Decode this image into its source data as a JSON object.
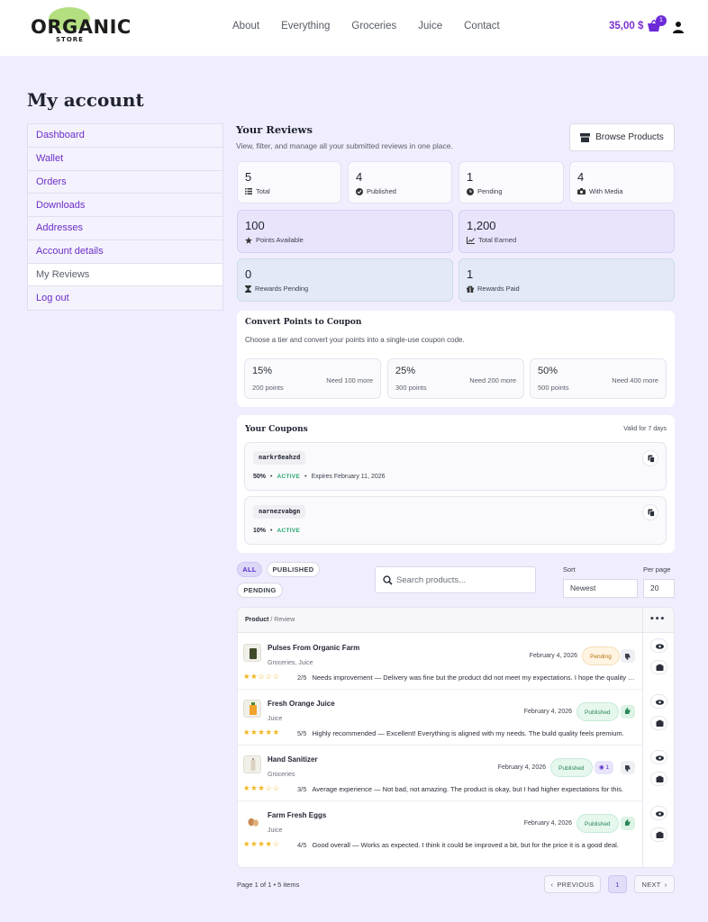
{
  "brand": {
    "logo_main": "ORGANIC",
    "logo_sub": "STORE"
  },
  "nav": [
    {
      "label": "About"
    },
    {
      "label": "Everything"
    },
    {
      "label": "Groceries"
    },
    {
      "label": "Juice"
    },
    {
      "label": "Contact"
    }
  ],
  "cart": {
    "total": "35,00 $",
    "count": "1"
  },
  "page_title": "My account",
  "sidebar": {
    "items": [
      {
        "label": "Dashboard"
      },
      {
        "label": "Wallet"
      },
      {
        "label": "Orders"
      },
      {
        "label": "Downloads"
      },
      {
        "label": "Addresses"
      },
      {
        "label": "Account details"
      },
      {
        "label": "My Reviews"
      },
      {
        "label": "Log out"
      }
    ],
    "active": "My Reviews"
  },
  "reviews": {
    "title": "Your Reviews",
    "subtitle": "View, filter, and manage all your submitted reviews in one place.",
    "browse_label": "Browse Products"
  },
  "stats": {
    "total": {
      "value": "5",
      "label": "Total"
    },
    "published": {
      "value": "4",
      "label": "Published"
    },
    "pending": {
      "value": "1",
      "label": "Pending"
    },
    "media": {
      "value": "4",
      "label": "With Media"
    },
    "points_available": {
      "value": "100",
      "label": "Points Available"
    },
    "total_earned": {
      "value": "1,200",
      "label": "Total Earned"
    },
    "rewards_pending": {
      "value": "0",
      "label": "Rewards Pending"
    },
    "rewards_paid": {
      "value": "1",
      "label": "Rewards Paid"
    }
  },
  "convert": {
    "title": "Convert Points to Coupon",
    "subtitle": "Choose a tier and convert your points into a single-use coupon code.",
    "tiers": [
      {
        "pct": "15%",
        "points": "200 points",
        "need": "Need 100 more"
      },
      {
        "pct": "25%",
        "points": "300 points",
        "need": "Need 200 more"
      },
      {
        "pct": "50%",
        "points": "500 points",
        "need": "Need 400 more"
      }
    ]
  },
  "coupons": {
    "title": "Your Coupons",
    "validity": "Valid for 7 days",
    "items": [
      {
        "code": "narkr8eahzd",
        "discount": "50%",
        "status": "ACTIVE",
        "expires": "Expires February 11, 2026"
      },
      {
        "code": "narnezvabgn",
        "discount": "10%",
        "status": "ACTIVE",
        "expires": ""
      }
    ]
  },
  "filters": {
    "all": "ALL",
    "published": "PUBLISHED",
    "pending": "PENDING",
    "search_placeholder": "Search products...",
    "sort_label": "Sort",
    "sort_value": "Newest",
    "per_page_label": "Per page",
    "per_page_value": "20"
  },
  "table": {
    "header_product": "Product",
    "header_review": "/ Review",
    "header_actions": "•••",
    "rows": [
      {
        "name": "Pulses From Organic Farm",
        "category": "Groceries, Juice",
        "date": "February 4, 2026",
        "status": "Pending",
        "rating": 2,
        "score": "2/5",
        "text": "Needs improvement — Delivery was fine but the product did not meet my expectations. I hope the quality gets better next time."
      },
      {
        "name": "Fresh Orange Juice",
        "category": "Juice",
        "date": "February 4, 2026",
        "status": "Published",
        "rating": 5,
        "score": "5/5",
        "text": "Highly recommended — Excellent! Everything is aligned with my needs. The build quality feels premium."
      },
      {
        "name": "Hand Sanitizer",
        "category": "Groceries",
        "date": "February 4, 2026",
        "status": "Published",
        "media_count": "1",
        "rating": 3,
        "score": "3/5",
        "text": "Average experience — Not bad, not amazing. The product is okay, but I had higher expectations for this."
      },
      {
        "name": "Farm Fresh Eggs",
        "category": "Juice",
        "date": "February 4, 2026",
        "status": "Published",
        "rating": 4,
        "score": "4/5",
        "text": "Good overall — Works as expected. I think it could be improved a bit, but for the price it is a good deal."
      }
    ]
  },
  "pagination": {
    "summary": "Page 1 of 1 • 5 items",
    "previous": "PREVIOUS",
    "current": "1",
    "next": "NEXT"
  },
  "colors": {
    "accent": "#6c2bd9",
    "published": "#2a8757",
    "pending": "#b77212",
    "star": "#f3b51c"
  }
}
